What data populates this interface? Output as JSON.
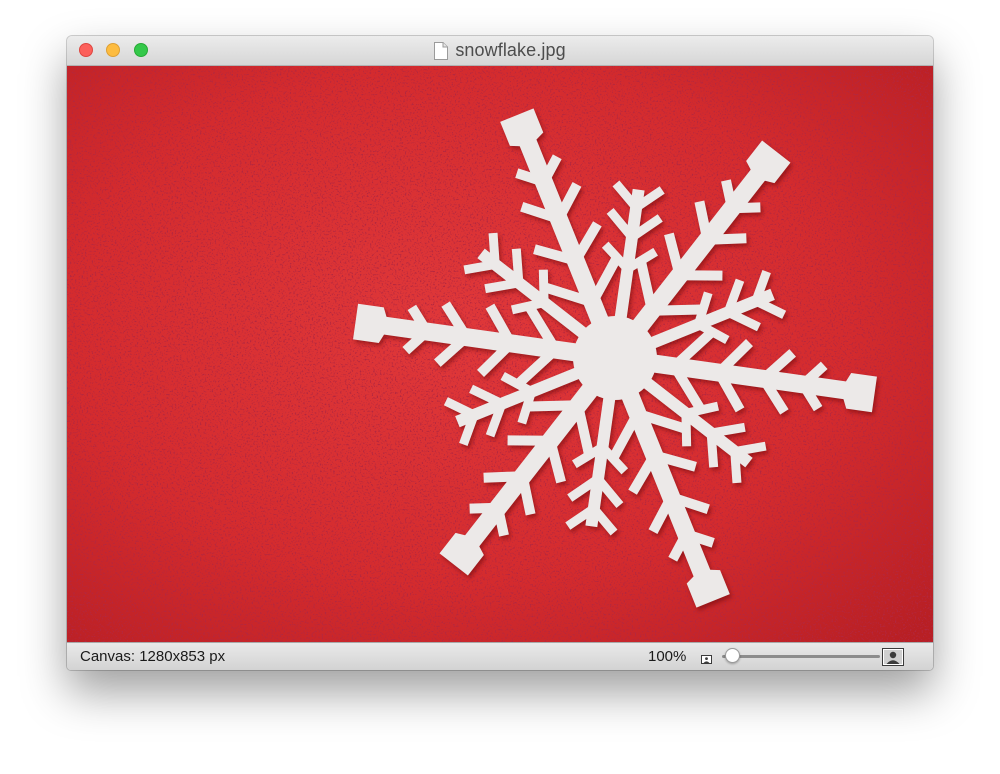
{
  "window": {
    "title": "snowflake.jpg",
    "icons": {
      "close": "close-button",
      "minimize": "minimize-button",
      "zoom": "zoom-button",
      "document": "document-icon"
    }
  },
  "image": {
    "description_icon": "image-canvas",
    "colors": {
      "background": "#d42b2e",
      "snowflake": "#ece9e8"
    }
  },
  "statusbar": {
    "canvas_label": "Canvas: 1280x853 px",
    "zoom_percent": "100%",
    "zoom_slider_value": 0.0,
    "icons": {
      "small": "zoom-out-image-icon",
      "large": "zoom-in-image-icon"
    }
  }
}
